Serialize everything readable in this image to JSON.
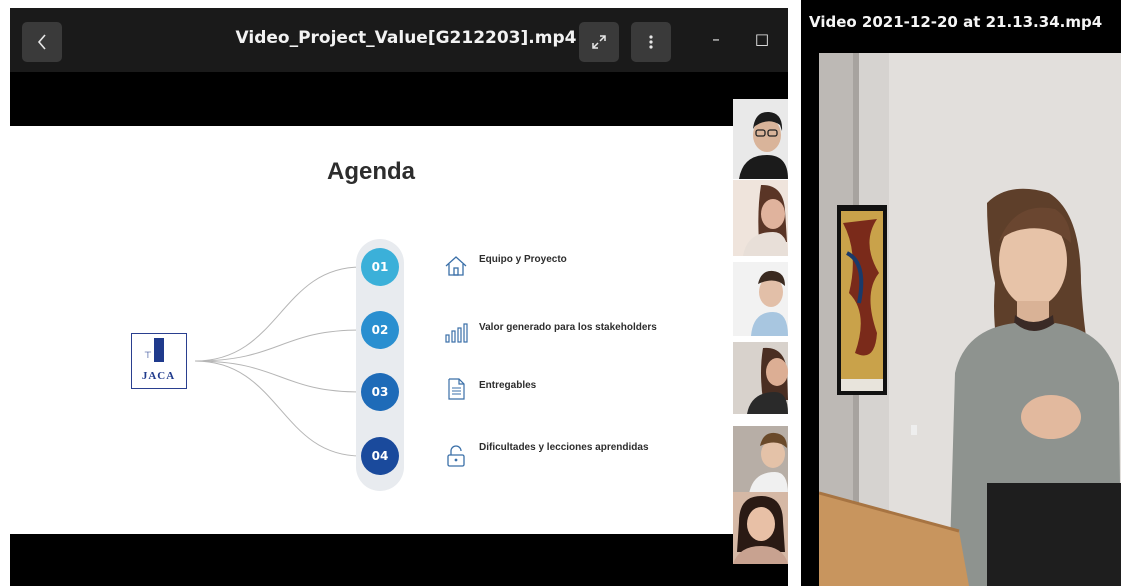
{
  "left_window": {
    "title": "Video_Project_Value[G212203].mp4",
    "back_icon": "chevron-left-icon",
    "expand_icon": "expand-icon",
    "menu_icon": "kebab-menu-icon",
    "minimize_glyph": "–",
    "maximize_glyph": "□"
  },
  "slide": {
    "title": "Agenda",
    "logo_text": "JACA",
    "logo_mark": "I",
    "items": [
      {
        "number": "01",
        "label": "Equipo y Proyecto",
        "icon": "house-icon"
      },
      {
        "number": "02",
        "label": "Valor generado para los stakeholders",
        "icon": "bar-chart-icon"
      },
      {
        "number": "03",
        "label": "Entregables",
        "icon": "document-icon"
      },
      {
        "number": "04",
        "label": "Dificultades y lecciones aprendidas",
        "icon": "padlock-icon"
      }
    ],
    "colors": {
      "n1": "#3bb0d9",
      "n2": "#2a8fd0",
      "n3": "#1e6bb8",
      "n4": "#1a4a9c"
    }
  },
  "participants": [
    {
      "id": "participant-1"
    },
    {
      "id": "participant-2"
    },
    {
      "id": "participant-3"
    },
    {
      "id": "participant-4"
    },
    {
      "id": "participant-5"
    },
    {
      "id": "participant-6"
    }
  ],
  "right_window": {
    "title": "Video 2021-12-20 at 21.13.34.mp4"
  }
}
